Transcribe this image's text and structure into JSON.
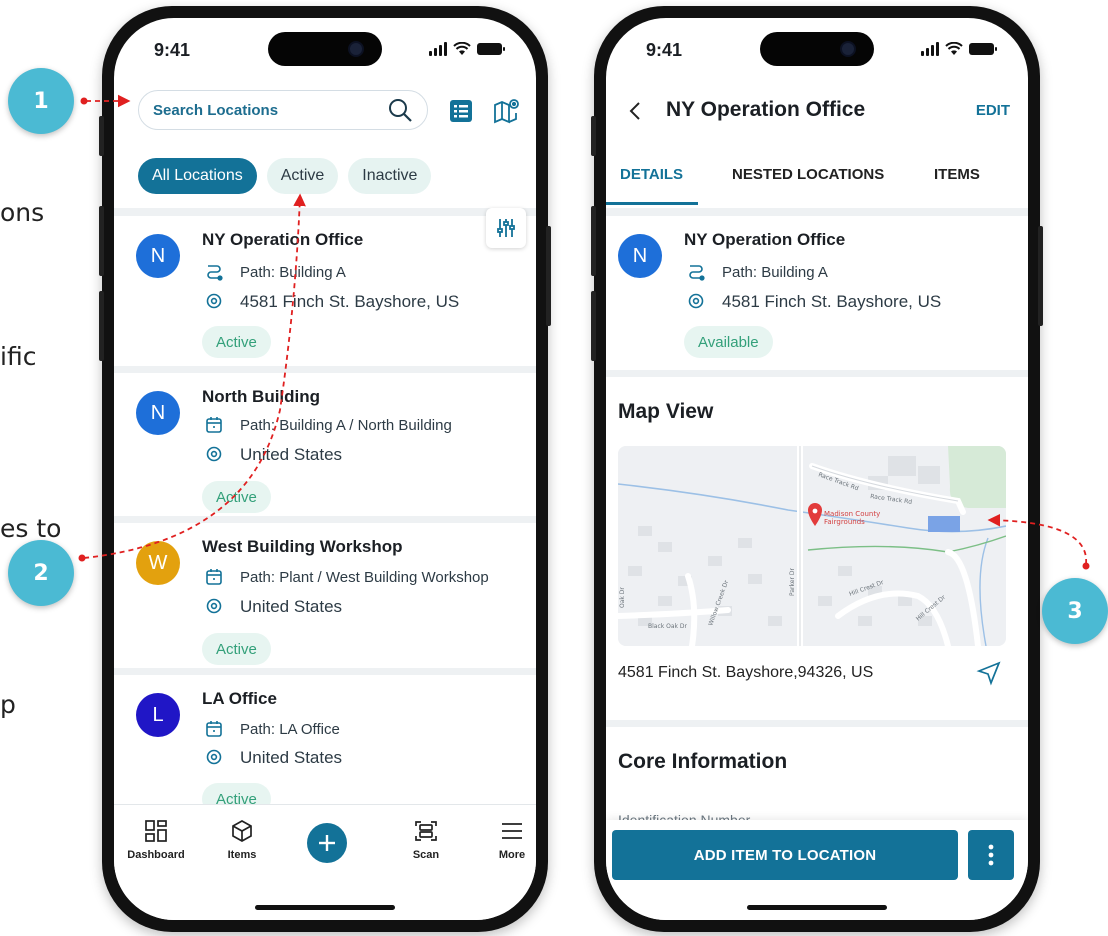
{
  "side_texts": [
    "ons",
    "ific",
    "es to",
    "p"
  ],
  "markers": [
    "1",
    "2",
    "3"
  ],
  "status": {
    "time": "9:41"
  },
  "list_screen": {
    "search": {
      "placeholder": "Search Locations"
    },
    "filters": [
      "All Locations",
      "Active",
      "Inactive"
    ],
    "locations": [
      {
        "initial": "N",
        "name": "NY Operation Office",
        "path": "Path: Building A",
        "address": "4581 Finch St. Bayshore, US",
        "status": "Active",
        "color": "#1e6fd9"
      },
      {
        "initial": "N",
        "name": "North Building",
        "path": "Path: Building A / North Building",
        "address": "United States",
        "status": "Active",
        "color": "#1e6fd9"
      },
      {
        "initial": "W",
        "name": "West Building Workshop",
        "path": "Path: Plant / West Building Workshop",
        "address": "United States",
        "status": "Active",
        "color": "#e3a10e"
      },
      {
        "initial": "L",
        "name": "LA Office",
        "path": "Path: LA Office",
        "address": "United States",
        "status": "Active",
        "color": "#2016c6"
      }
    ],
    "tabbar": {
      "dashboard": "Dashboard",
      "items": "Items",
      "scan": "Scan",
      "more": "More"
    }
  },
  "detail_screen": {
    "title": "NY Operation Office",
    "edit": "EDIT",
    "tabs": [
      "DETAILS",
      "NESTED LOCATIONS",
      "ITEMS"
    ],
    "card": {
      "initial": "N",
      "name": "NY Operation Office",
      "path": "Path: Building A",
      "address": "4581 Finch St. Bayshore, US",
      "status": "Available"
    },
    "map_title": "Map View",
    "map_labels": {
      "place": "Madison County",
      "place2": "Fairgrounds",
      "road1": "Race Track Rd",
      "road2": "Race Track Rd",
      "road3": "Hill Crest Dr",
      "road4": "Black Oak Dr",
      "road5": "Parker Dr",
      "road6": "Hill Crest Dr",
      "road7": "Willow Creek Dr",
      "road8": "Oak Dr"
    },
    "address_line": "4581 Finch St. Bayshore,94326, US",
    "core_title": "Core Information",
    "id_label": "Identification Number",
    "primary_action": "ADD ITEM TO LOCATION"
  },
  "colors": {
    "brand": "#137298",
    "marker": "#4bbad3",
    "active_badge_bg": "#e7f5f1",
    "active_badge_text": "#33a07a",
    "annotation": "#e02020"
  }
}
